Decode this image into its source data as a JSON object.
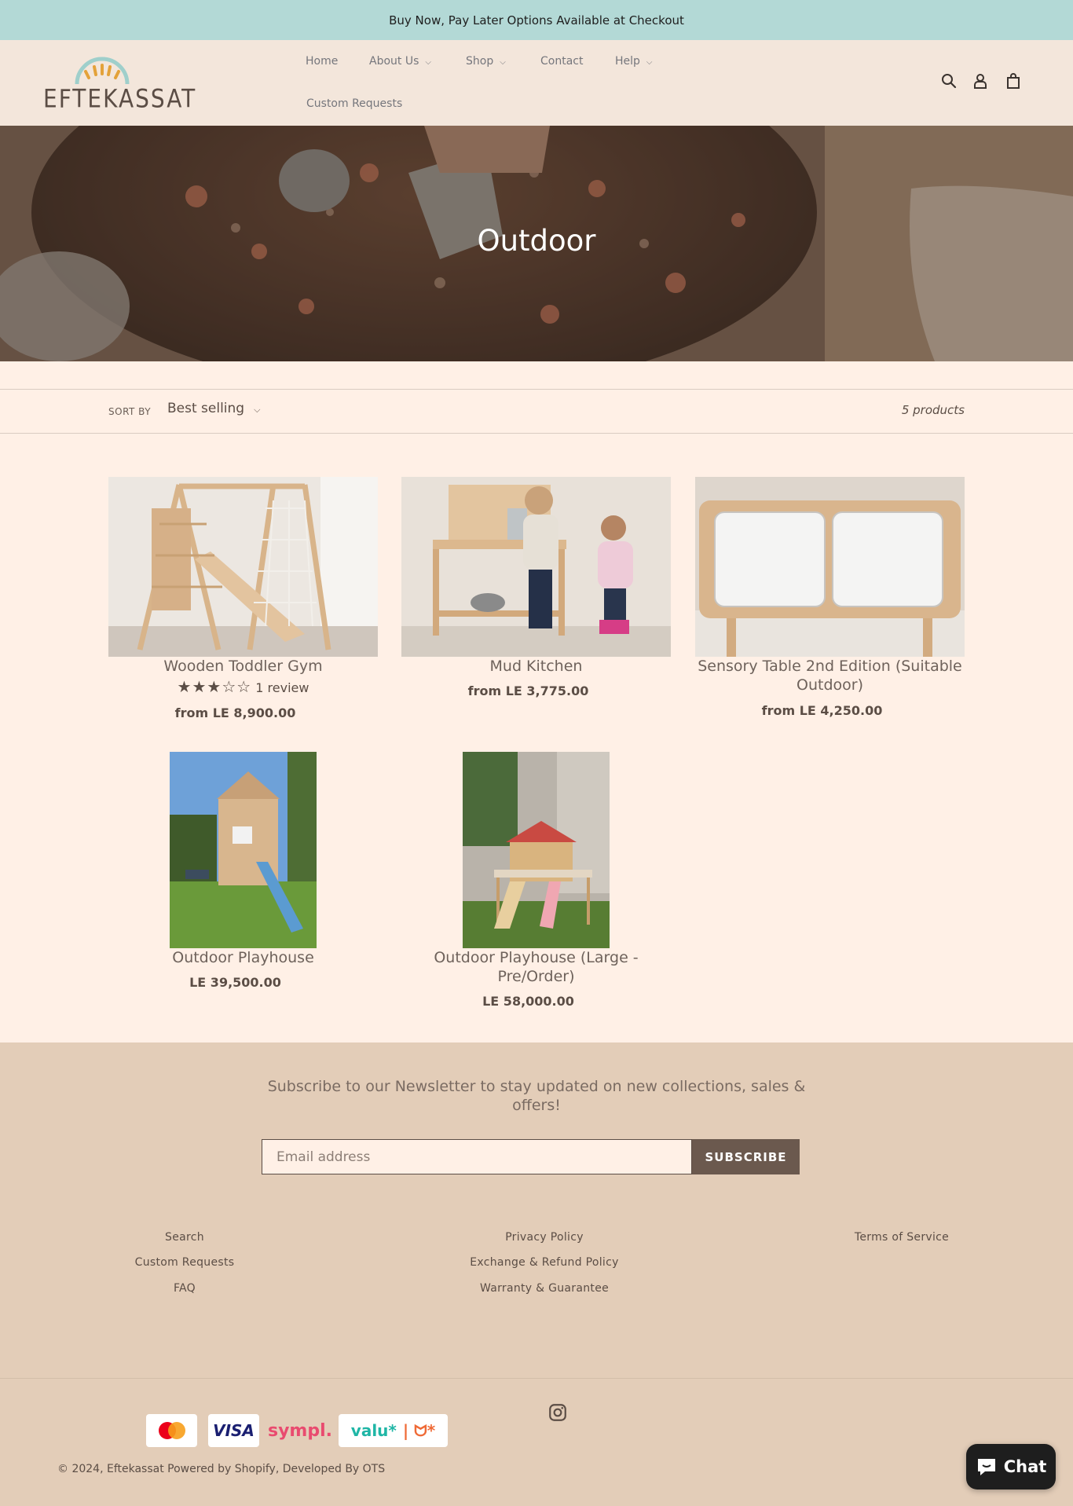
{
  "announcement": "Buy Now, Pay Later Options Available at Checkout",
  "brand": {
    "name": "EFTEKASSAT"
  },
  "nav": {
    "items": [
      {
        "label": "Home",
        "has_dropdown": false
      },
      {
        "label": "About Us",
        "has_dropdown": true
      },
      {
        "label": "Shop",
        "has_dropdown": true
      },
      {
        "label": "Contact",
        "has_dropdown": false
      },
      {
        "label": "Help",
        "has_dropdown": true
      },
      {
        "label": "Custom Requests",
        "has_dropdown": false
      }
    ],
    "icons": [
      "search-icon",
      "account-icon",
      "cart-icon"
    ]
  },
  "hero": {
    "title": "Outdoor"
  },
  "sort": {
    "label": "SORT BY",
    "selected": "Best selling"
  },
  "product_count": "5 products",
  "products": [
    {
      "title": "Wooden Toddler Gym",
      "price": "from LE 8,900.00",
      "rating": 3,
      "rating_max": 5,
      "reviews": "1 review"
    },
    {
      "title": "Mud Kitchen",
      "price": "from LE 3,775.00"
    },
    {
      "title": "Sensory Table 2nd Edition (Suitable Outdoor)",
      "price": "from LE 4,250.00"
    },
    {
      "title": "Outdoor Playhouse",
      "price": "LE 39,500.00"
    },
    {
      "title": "Outdoor Playhouse (Large - Pre/Order)",
      "price": "LE 58,000.00"
    }
  ],
  "footer": {
    "newsletter": "Subscribe to our Newsletter to stay updated on new collections, sales & offers!",
    "email_placeholder": "Email address",
    "subscribe_label": "SUBSCRIBE",
    "links_col1": [
      "Search",
      "Custom Requests",
      "FAQ"
    ],
    "links_col2": [
      "Privacy Policy",
      "Exchange & Refund Policy",
      "Warranty & Guarantee"
    ],
    "links_col3": [
      "Terms of Service"
    ],
    "payments": [
      "Mastercard",
      "VISA",
      "sympl.",
      "valu*",
      "contact*"
    ],
    "social": "instagram-icon",
    "copyright_prefix": "© 2024,",
    "copyright_link": "Eftekassat",
    "copyright_suffix": "Powered by Shopify, Developed By OTS"
  },
  "chat_label": "Chat",
  "colors": {
    "announcement_bg": "#b3d9d6",
    "header_bg": "#f3e6db",
    "page_bg": "#fff0e6",
    "footer_bg": "#e3cdb8",
    "button_bg": "#6b594e"
  }
}
